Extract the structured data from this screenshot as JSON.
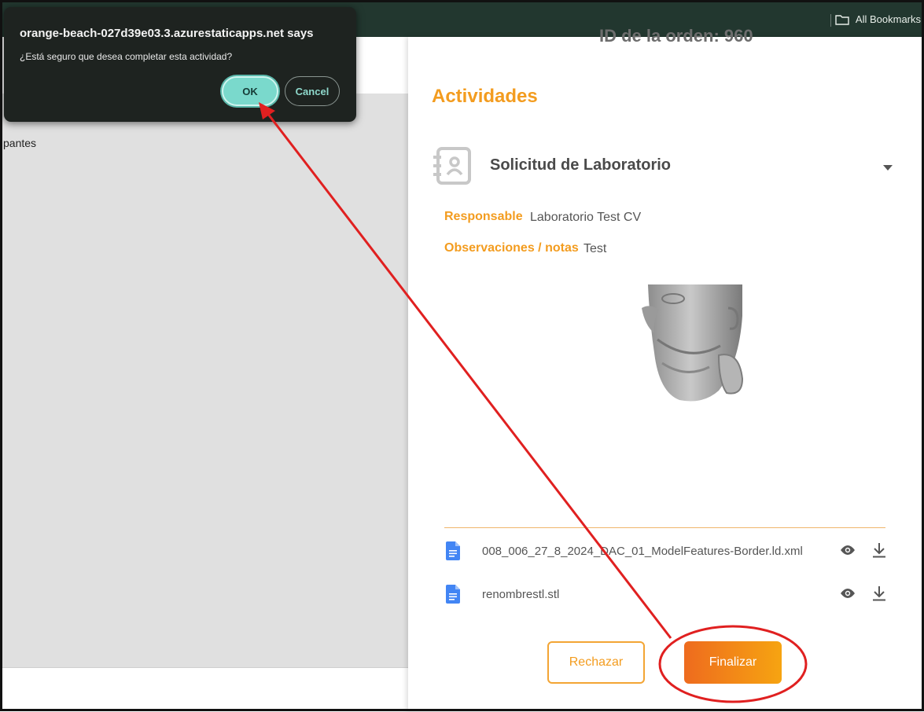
{
  "browser": {
    "bookmarks_label": "All Bookmarks"
  },
  "background_page": {
    "partial_text": "pantes"
  },
  "panel": {
    "order_id": "ID de la orden: 960",
    "section_title": "Actividades",
    "activity": {
      "title": "Solicitud de Laboratorio",
      "responsible_label": "Responsable",
      "responsible_value": "Laboratorio Test CV",
      "notes_label": "Observaciones / notas",
      "notes_value": "Test"
    },
    "files": [
      {
        "name": "008_006_27_8_2024_DAC_01_ModelFeatures-Border.ld.xml"
      },
      {
        "name": "renombrestl.stl"
      }
    ],
    "buttons": {
      "reject": "Rechazar",
      "finish": "Finalizar"
    }
  },
  "dialog": {
    "title": "orange-beach-027d39e03.3.azurestaticapps.net says",
    "message": "¿Está seguro que desea completar esta actividad?",
    "ok_label": "OK",
    "cancel_label": "Cancel"
  },
  "colors": {
    "accent": "#f39c1f",
    "topbar": "#22372f",
    "dialog_bg": "#1e2320",
    "ok_button": "#7ad9cc",
    "annotation": "#e02020"
  },
  "icons": [
    "folder-icon",
    "contacts-book-icon",
    "caret-down-icon",
    "document-icon",
    "eye-icon",
    "download-icon"
  ]
}
